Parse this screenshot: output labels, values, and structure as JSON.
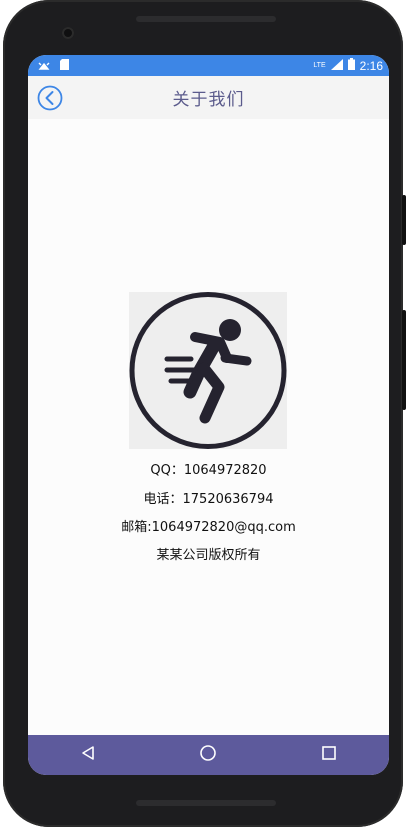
{
  "status_bar": {
    "time": "2:16",
    "network_label": "LTE",
    "left_icons": [
      "android-debug-icon",
      "sd-card-icon"
    ],
    "right_icons": [
      "signal-icon",
      "battery-icon"
    ]
  },
  "app_bar": {
    "title": "关于我们",
    "back_icon": "back-arrow-circle-icon",
    "accent_color": "#3d86e6",
    "title_color": "#5b5b8c"
  },
  "about": {
    "logo_icon": "running-person-icon",
    "qq_line": "QQ：1064972820",
    "phone_line": "电话：17520636794",
    "email_line": "邮箱:1064972820@qq.com",
    "copyright_line": "某某公司版权所有"
  },
  "nav_bar": {
    "color": "#5d5a9c",
    "buttons": [
      "back-triangle-icon",
      "home-circle-icon",
      "recents-square-icon"
    ]
  }
}
